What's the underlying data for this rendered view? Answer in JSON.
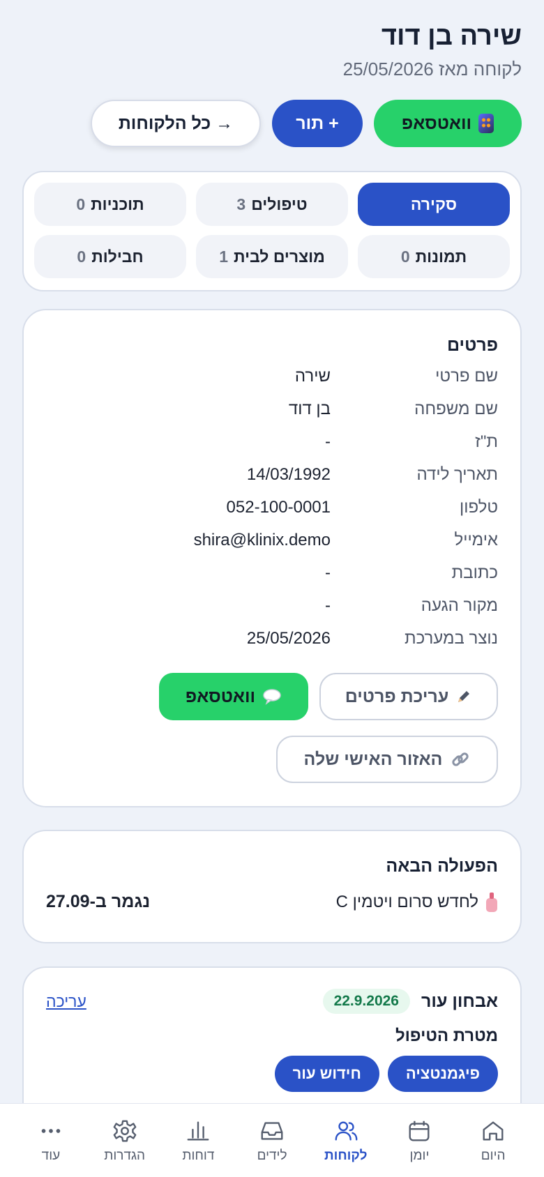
{
  "header": {
    "name": "שירה בן דוד",
    "since": "לקוחה מאז 25/05/2026"
  },
  "actions": {
    "whatsapp": "וואטסאפ",
    "appointment": "+ תור",
    "all_clients": "→ כל הלקוחות"
  },
  "tabs": [
    {
      "label": "סקירה",
      "count": ""
    },
    {
      "label": "טיפולים",
      "count": "3"
    },
    {
      "label": "תוכניות",
      "count": "0"
    },
    {
      "label": "תמונות",
      "count": "0"
    },
    {
      "label": "מוצרים לבית",
      "count": "1"
    },
    {
      "label": "חבילות",
      "count": "0"
    }
  ],
  "details": {
    "title": "פרטים",
    "rows": [
      {
        "label": "שם פרטי",
        "value": "שירה"
      },
      {
        "label": "שם משפחה",
        "value": "בן דוד"
      },
      {
        "label": "ת\"ז",
        "value": "-"
      },
      {
        "label": "תאריך לידה",
        "value": "14/03/1992"
      },
      {
        "label": "טלפון",
        "value": "052-100-0001"
      },
      {
        "label": "אימייל",
        "value": "shira@klinix.demo"
      },
      {
        "label": "כתובת",
        "value": "-"
      },
      {
        "label": "מקור הגעה",
        "value": "-"
      },
      {
        "label": "נוצר במערכת",
        "value": "25/05/2026"
      }
    ],
    "edit_label": "עריכת פרטים",
    "whatsapp_label": "וואטסאפ",
    "portal_label": "האזור האישי שלה"
  },
  "next_action": {
    "title": "הפעולה הבאה",
    "item": "לחדש סרום ויטמין C",
    "due": "נגמר ב-27.09"
  },
  "exam": {
    "title": "אבחון עור",
    "date": "22.9.2026",
    "edit": "עריכה",
    "goal_title": "מטרת הטיפול",
    "chips": [
      "פיגמנטציה",
      "חידוש עור"
    ]
  },
  "nav": [
    {
      "label": "היום",
      "icon": "home-icon"
    },
    {
      "label": "יומן",
      "icon": "calendar-icon"
    },
    {
      "label": "לקוחות",
      "icon": "users-icon",
      "active": true
    },
    {
      "label": "לידים",
      "icon": "inbox-icon"
    },
    {
      "label": "דוחות",
      "icon": "bar-chart-icon"
    },
    {
      "label": "הגדרות",
      "icon": "gear-icon"
    },
    {
      "label": "עוד",
      "icon": "more-icon"
    }
  ],
  "colors": {
    "primary": "#2a52c7",
    "whatsapp": "#27d16a",
    "background": "#eef2f9"
  }
}
